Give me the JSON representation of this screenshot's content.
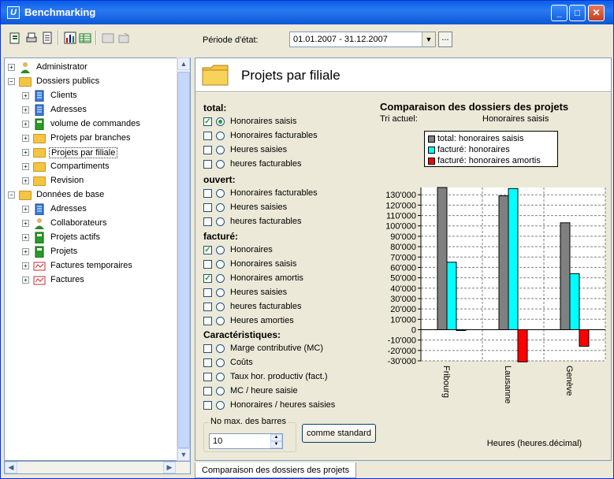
{
  "window": {
    "title": "Benchmarking",
    "icon_letter": "U"
  },
  "toolbar": {
    "period_label": "Période d'état:",
    "period_value": "01.01.2007 - 31.12.2007",
    "dots_label": "..."
  },
  "tree": {
    "items": [
      {
        "label": "Administrator",
        "icon": "user-icon"
      },
      {
        "label": "Dossiers publics",
        "icon": "folder-icon"
      },
      {
        "label": "Clients",
        "icon": "building-icon"
      },
      {
        "label": "Adresses",
        "icon": "building-icon"
      },
      {
        "label": "volume de commandes",
        "icon": "green-report-icon"
      },
      {
        "label": "Projets par branches",
        "icon": "folder-icon"
      },
      {
        "label": "Projets par filiale",
        "icon": "folder-icon"
      },
      {
        "label": "Compartiments",
        "icon": "folder-icon"
      },
      {
        "label": "Revision",
        "icon": "folder-icon"
      },
      {
        "label": "Données de base",
        "icon": "folder-icon"
      },
      {
        "label": "Adresses",
        "icon": "building-icon"
      },
      {
        "label": "Collaborateurs",
        "icon": "user-icon"
      },
      {
        "label": "Projets actifs",
        "icon": "green-report-icon"
      },
      {
        "label": "Projets",
        "icon": "green-report-icon"
      },
      {
        "label": "Factures temporaires",
        "icon": "invoice-icon"
      },
      {
        "label": "Factures",
        "icon": "invoice-icon"
      }
    ]
  },
  "main": {
    "title": "Projets par filiale",
    "sections": {
      "total": "total:",
      "ouvert": "ouvert:",
      "facture": "facturé:",
      "caract": "Caractéristiques:"
    },
    "options": {
      "total": [
        "Honoraires saisis",
        "Honoraires facturables",
        "Heures saisies",
        "heures facturables"
      ],
      "ouvert": [
        "Honoraires facturables",
        "Heures saisies",
        "heures facturables"
      ],
      "facture": [
        "Honoraires",
        "Honoraires saisis",
        "Honoraires amortis",
        "Heures saisies",
        "heures facturables",
        "Heures amorties"
      ],
      "caract": [
        "Marge contributive (MC)",
        "Coûts",
        "Taux hor. productiv (fact.)",
        "MC / heure saisie",
        "Honoraires / heures saisies"
      ]
    },
    "max_bars_label": "No max. des barres",
    "max_bars_value": "10",
    "standard_button": "comme standard",
    "tab_label": "Comparaison des dossiers des projets"
  },
  "chart_data": {
    "type": "bar",
    "title": "Comparaison des dossiers des projets",
    "sort_label": "Tri actuel:",
    "sort_value": "Honoraires saisis",
    "categories": [
      "Fribourg",
      "Lausanne",
      "Genève"
    ],
    "series": [
      {
        "name": "total: honoraires saisis",
        "color": "#808080",
        "values": [
          137000,
          129000,
          103000
        ]
      },
      {
        "name": "facturé: honoraires",
        "color": "#00ffff",
        "values": [
          65000,
          136000,
          54000
        ]
      },
      {
        "name": "facturé: honoraires amortis",
        "color": "#ff0000",
        "values": [
          -500,
          -31000,
          -16000
        ]
      }
    ],
    "xlabel": "Heures (heures.décimal)",
    "ylim": [
      -30000,
      137000
    ],
    "yticks": [
      "130'000",
      "120'000",
      "110'000",
      "100'000",
      "90'000",
      "80'000",
      "70'000",
      "60'000",
      "50'000",
      "40'000",
      "30'000",
      "20'000",
      "10'000",
      "0",
      "-10'000",
      "-20'000",
      "-30'000"
    ],
    "grid": true,
    "legend_position": "top-right"
  }
}
